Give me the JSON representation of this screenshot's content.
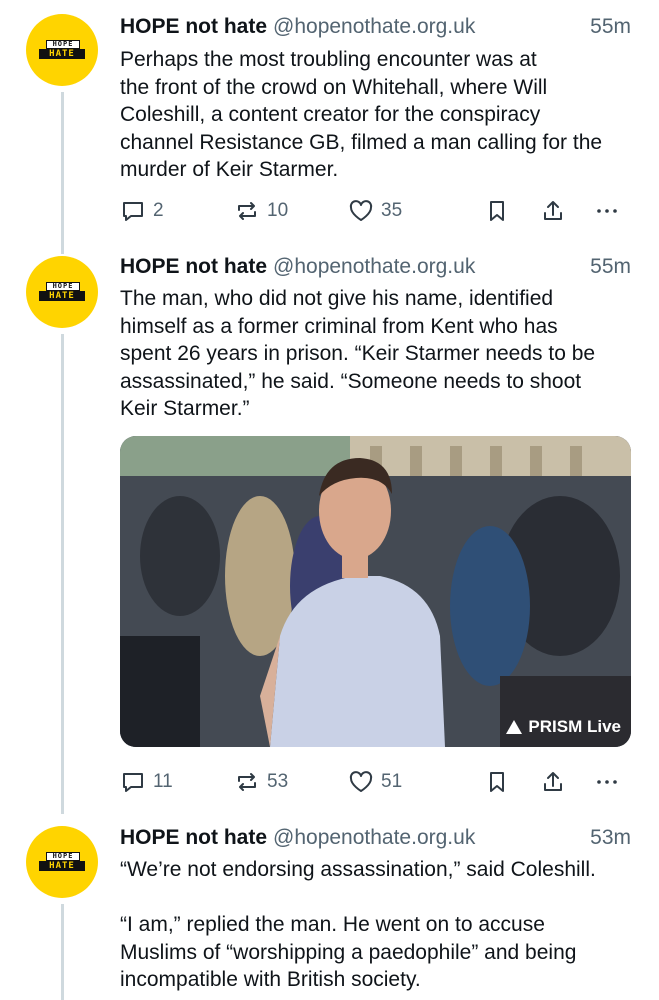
{
  "posts": [
    {
      "author": "HOPE not hate",
      "handle": "@hopenothate.org.uk",
      "time": "55m",
      "avatar_top": "HOPE",
      "avatar_bottom": "HATE",
      "text": "Perhaps the most troubling encounter was at\nthe front of the crowd on Whitehall, where Will\nColeshill, a content creator for the conspiracy\nchannel Resistance GB, filmed a man calling for the\nmurder of Keir Starmer.",
      "replies": "2",
      "reposts": "10",
      "likes": "35"
    },
    {
      "author": "HOPE not hate",
      "handle": "@hopenothate.org.uk",
      "time": "55m",
      "avatar_top": "HOPE",
      "avatar_bottom": "HATE",
      "text": "The man, who did not give his name, identified\nhimself as a former criminal from Kent who has\nspent 26 years in prison. “Keir Starmer needs to be\nassassinated,” he said. “Someone needs to shoot\nKeir Starmer.”",
      "media_watermark": "PRISM Live",
      "replies": "11",
      "reposts": "53",
      "likes": "51"
    },
    {
      "author": "HOPE not hate",
      "handle": "@hopenothate.org.uk",
      "time": "53m",
      "avatar_top": "HOPE",
      "avatar_bottom": "HATE",
      "text": "“We’re not endorsing assassination,” said Coleshill.\n\n“I am,” replied the man. He went on to accuse\nMuslims of “worshipping a paedophile” and being\nincompatible with British society."
    }
  ],
  "colors": {
    "avatar_bg": "#ffd400",
    "muted": "#536471",
    "thread_line": "#cfd9de"
  },
  "icons": [
    "reply-icon",
    "repost-icon",
    "like-icon",
    "bookmark-icon",
    "share-icon",
    "more-icon"
  ]
}
